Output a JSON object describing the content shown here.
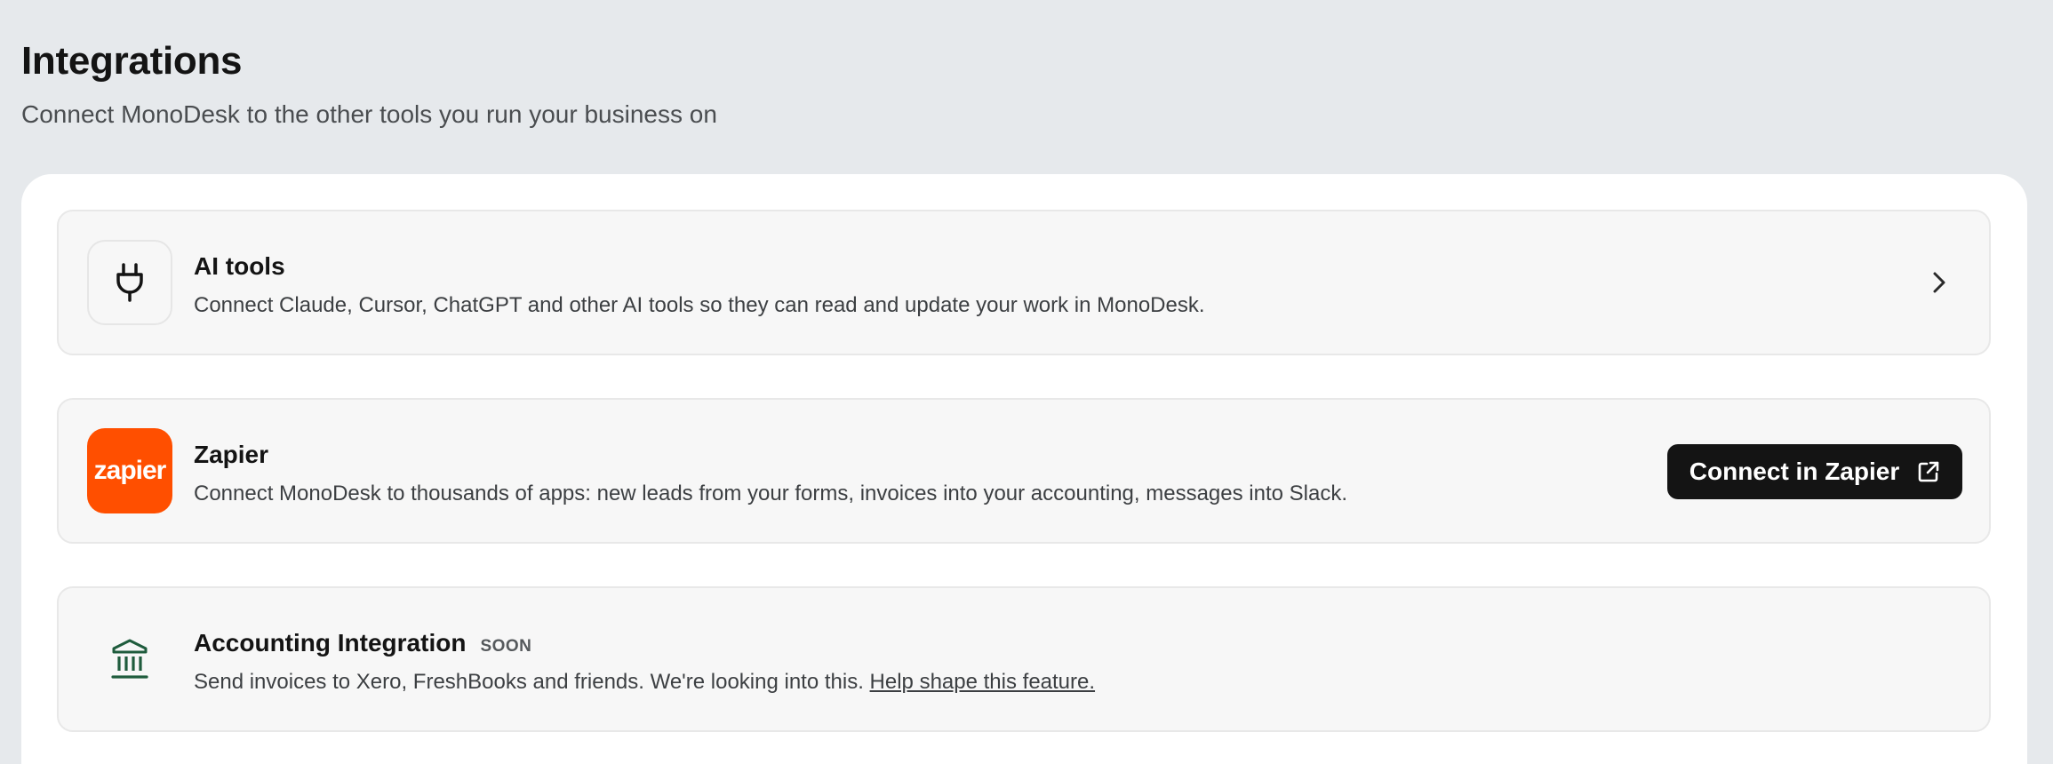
{
  "header": {
    "title": "Integrations",
    "subtitle": "Connect MonoDesk to the other tools you run your business on"
  },
  "integrations": [
    {
      "title": "AI tools",
      "description": "Connect Claude, Cursor, ChatGPT and other AI tools so they can read and update your work in MonoDesk.",
      "icon": "plug-icon",
      "action": "chevron-right-icon"
    },
    {
      "title": "Zapier",
      "description": "Connect MonoDesk to thousands of apps: new leads from your forms, invoices into your accounting, messages into Slack.",
      "logo_text": "zapier",
      "logo_color": "#ff4f00",
      "button_label": "Connect in Zapier",
      "button_icon": "external-link-icon"
    },
    {
      "title": "Accounting Integration",
      "badge": "SOON",
      "description": "Send invoices to Xero, FreshBooks and friends. We're looking into this.",
      "link_text": "Help shape this feature.",
      "icon": "bank-icon",
      "icon_color": "#1f5c3d"
    }
  ],
  "colors": {
    "page_background": "#e6e9ec",
    "panel_background": "#ffffff",
    "card_background": "#f7f7f7",
    "button_background": "#141414"
  }
}
